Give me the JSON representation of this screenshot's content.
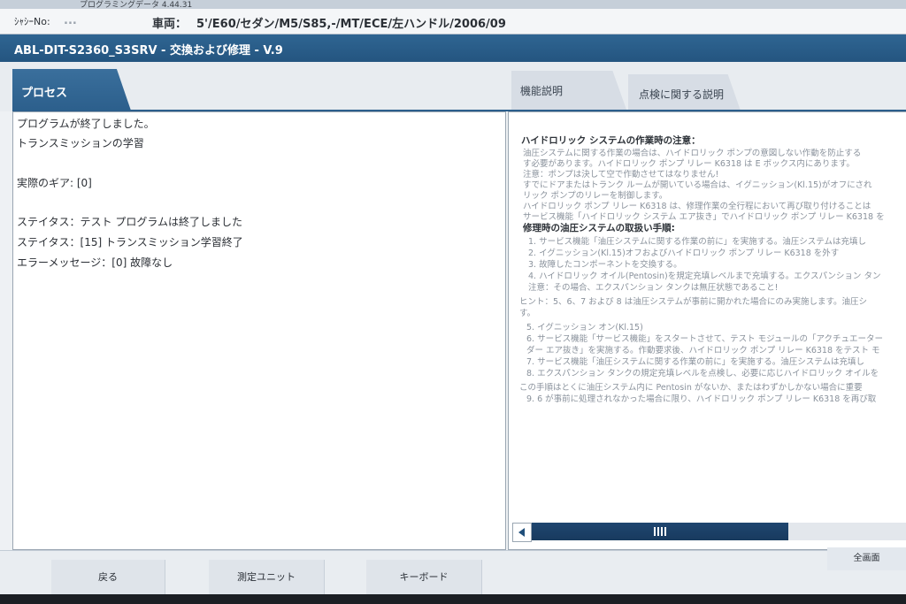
{
  "top_strip": {
    "text": "プログラミングデータ  4.44.31"
  },
  "vehicle_bar": {
    "chassis_label": "ｼｬｼｰNo:",
    "chassis_value": "...",
    "vehicle_label": "車両：",
    "vehicle_value": "5'/E60/セダン/M5/S85,-/MT/ECE/左ハンドル/2006/09"
  },
  "window": {
    "title": "ABL-DIT-S2360_S3SRV - 交換および修理 - V.9"
  },
  "tabs": {
    "process": "プロセス",
    "function_desc": "機能説明",
    "inspection_desc": "点検に関する説明"
  },
  "left_panel": {
    "lines": [
      "プログラムが終了しました。",
      "トランスミッションの学習",
      "実際のギア: [0]",
      "ステイタス：テスト プログラムは終了しました",
      "ステイタス：[15] トランスミッション学習終了",
      "エラーメッセージ：[0] 故障なし"
    ]
  },
  "right_panel": {
    "heading1": "ハイドロリック システムの作業時の注意：",
    "para1": [
      "油圧システムに関する作業の場合は、ハイドロリック ポンプの意図しない作動を防止する",
      "す必要があります。ハイドロリック ポンプ リレー K6318 は E ボックス内にあります。",
      "注意：ポンプは決して空で作動させてはなりません!",
      "すでにドアまたはトランク ルームが開いている場合は、イグニッション(Kl.15)がオフにされ",
      "リック ポンプのリレーを制御します。",
      "ハイドロリック ポンプ リレー K6318 は、修理作業の全行程において再び取り付けることは",
      "サービス機能「ハイドロリック システム エア抜き」でハイドロリック ポンプ リレー K6318 を"
    ],
    "heading2": "修理時の油圧システムの取扱い手順:",
    "steps1": [
      "1. サービス機能「油圧システムに関する作業の前に」を実施する。油圧システムは充填し",
      "2. イグニッション(Kl.15)オフおよびハイドロリック ポンプ リレー K6318 を外す",
      "3. 故障したコンポーネントを交換する。",
      "4. ハイドロリック オイル(Pentosin)を規定充填レベルまで充填する。エクスパンション タン",
      "注意：その場合、エクスパンション タンクは無圧状態であること!"
    ],
    "hint": [
      "ヒント：5、6、7 および 8 は油圧システムが事前に開かれた場合にのみ実施します。油圧シ",
      "す。"
    ],
    "steps2": [
      "5. イグニッション オン(Kl.15)",
      "6. サービス機能「サービス機能」をスタートさせて、テスト モジュールの「アクチュエーター",
      "ダー エア抜き」を実施する。作動要求後、ハイドロリック ポンプ リレー K6318 をテスト モ",
      "7. サービス機能「油圧システムに関する作業の前に」を実施する。油圧システムは充填し",
      "8. エクスパンション タンクの規定充填レベルを点検し、必要に応じハイドロリック オイルを"
    ],
    "footer": [
      "この手順はとくに油圧システム内に Pentosin がないか、またはわずかしかない場合に重要",
      "9. 6 が事前に処理されなかった場合に限り、ハイドロリック ポンプ リレー K6318 を再び取"
    ]
  },
  "bottom_bar": {
    "back": "戻る",
    "measure_unit": "測定ユニット",
    "keyboard": "キーボード",
    "fullscreen": "全画面"
  }
}
